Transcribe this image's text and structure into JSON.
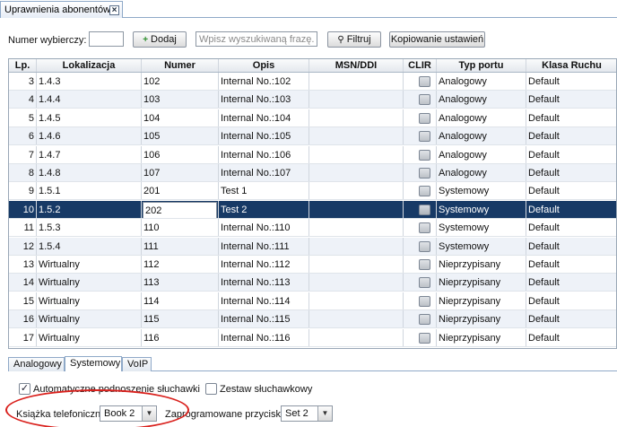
{
  "window_tab": {
    "title": "Uprawnienia abonentów",
    "close_icon": "close-icon"
  },
  "toolbar": {
    "number_label": "Numer wybierczy:",
    "number_value": "",
    "add_label": "Dodaj",
    "search_placeholder": "Wpisz wyszukiwaną frazę...",
    "filter_label": "Filtruj",
    "copy_label": "Kopiowanie ustawień"
  },
  "table": {
    "columns": [
      "Lp.",
      "Lokalizacja",
      "Numer",
      "Opis",
      "MSN/DDI",
      "CLIR",
      "Typ portu",
      "Klasa Ruchu"
    ],
    "rows": [
      {
        "lp": "3",
        "lok": "1.4.3",
        "num": "102",
        "opis": "Internal No.:102",
        "msn": "",
        "typ": "Analogowy",
        "klasa": "Default"
      },
      {
        "lp": "4",
        "lok": "1.4.4",
        "num": "103",
        "opis": "Internal No.:103",
        "msn": "",
        "typ": "Analogowy",
        "klasa": "Default"
      },
      {
        "lp": "5",
        "lok": "1.4.5",
        "num": "104",
        "opis": "Internal No.:104",
        "msn": "",
        "typ": "Analogowy",
        "klasa": "Default"
      },
      {
        "lp": "6",
        "lok": "1.4.6",
        "num": "105",
        "opis": "Internal No.:105",
        "msn": "",
        "typ": "Analogowy",
        "klasa": "Default"
      },
      {
        "lp": "7",
        "lok": "1.4.7",
        "num": "106",
        "opis": "Internal No.:106",
        "msn": "",
        "typ": "Analogowy",
        "klasa": "Default"
      },
      {
        "lp": "8",
        "lok": "1.4.8",
        "num": "107",
        "opis": "Internal No.:107",
        "msn": "",
        "typ": "Analogowy",
        "klasa": "Default"
      },
      {
        "lp": "9",
        "lok": "1.5.1",
        "num": "201",
        "opis": "Test 1",
        "msn": "",
        "typ": "Systemowy",
        "klasa": "Default"
      },
      {
        "lp": "10",
        "lok": "1.5.2",
        "num": "202",
        "opis": "Test 2",
        "msn": "",
        "typ": "Systemowy",
        "klasa": "Default"
      },
      {
        "lp": "11",
        "lok": "1.5.3",
        "num": "110",
        "opis": "Internal No.:110",
        "msn": "",
        "typ": "Systemowy",
        "klasa": "Default"
      },
      {
        "lp": "12",
        "lok": "1.5.4",
        "num": "111",
        "opis": "Internal No.:111",
        "msn": "",
        "typ": "Systemowy",
        "klasa": "Default"
      },
      {
        "lp": "13",
        "lok": "Wirtualny",
        "num": "112",
        "opis": "Internal No.:112",
        "msn": "",
        "typ": "Nieprzypisany",
        "klasa": "Default"
      },
      {
        "lp": "14",
        "lok": "Wirtualny",
        "num": "113",
        "opis": "Internal No.:113",
        "msn": "",
        "typ": "Nieprzypisany",
        "klasa": "Default"
      },
      {
        "lp": "15",
        "lok": "Wirtualny",
        "num": "114",
        "opis": "Internal No.:114",
        "msn": "",
        "typ": "Nieprzypisany",
        "klasa": "Default"
      },
      {
        "lp": "16",
        "lok": "Wirtualny",
        "num": "115",
        "opis": "Internal No.:115",
        "msn": "",
        "typ": "Nieprzypisany",
        "klasa": "Default"
      },
      {
        "lp": "17",
        "lok": "Wirtualny",
        "num": "116",
        "opis": "Internal No.:116",
        "msn": "",
        "typ": "Nieprzypisany",
        "klasa": "Default"
      }
    ],
    "selected_lp": "10",
    "selected_color": "#173a66"
  },
  "bottom_tabs": [
    "Analogowy",
    "Systemowy",
    "VoIP"
  ],
  "active_bottom_tab": "Systemowy",
  "options": {
    "auto_pickup_label": "Automatyczne podnoszenie słuchawki",
    "auto_pickup_checked": true,
    "headset_label": "Zestaw słuchawkowy",
    "headset_checked": false,
    "phonebook_label": "Książka telefoniczna",
    "phonebook_value": "Book 2",
    "keys_label": "Zaprogramowane przyciski",
    "keys_value": "Set 2"
  },
  "annotation_color": "#d9201c"
}
